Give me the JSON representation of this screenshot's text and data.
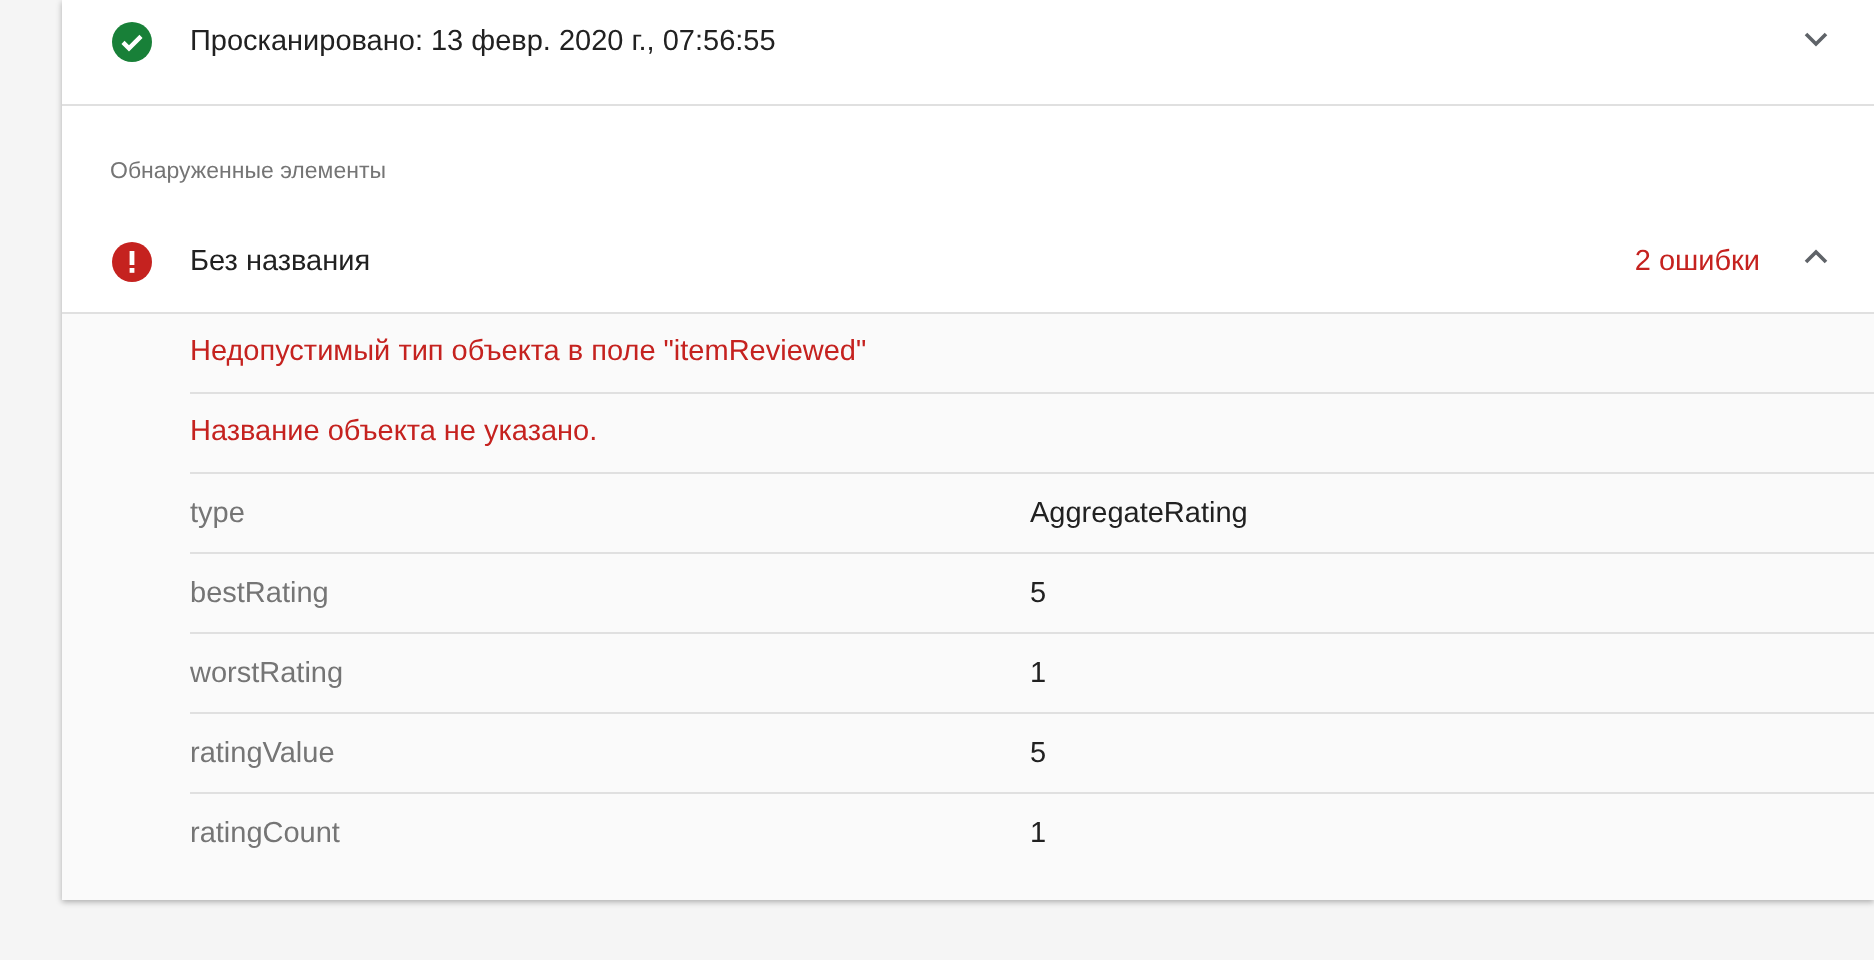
{
  "crawl": {
    "kind": "ok",
    "label": "Просканировано: 13 февр. 2020 г., 07:56:55",
    "expanded": false
  },
  "detected": {
    "heading": "Обнаруженные элементы",
    "items": [
      {
        "kind": "error",
        "title": "Без названия",
        "error_count": "2 ошибки",
        "expanded": true,
        "errors": [
          "Недопустимый тип объекта в поле \"itemReviewed\"",
          "Название объекта не указано."
        ],
        "properties": [
          {
            "name": "type",
            "value": "AggregateRating"
          },
          {
            "name": "bestRating",
            "value": "5"
          },
          {
            "name": "worstRating",
            "value": "1"
          },
          {
            "name": "ratingValue",
            "value": "5"
          },
          {
            "name": "ratingCount",
            "value": "1"
          }
        ]
      }
    ]
  }
}
